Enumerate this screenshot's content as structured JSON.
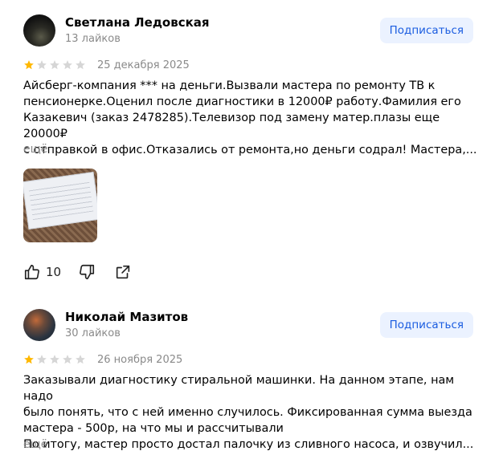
{
  "reviews": [
    {
      "author_name": "Светлана Ледовская",
      "likes_label": "13 лайков",
      "subscribe_label": "Подписаться",
      "rating": 1,
      "date": "25 декабря 2025",
      "text": "Айсберг-компания *** на деньги.Вызвали мастера по ремонту ТВ к\nпенсионерке.Оценил после диагностики в 12000₽ работу.Фамилия его\nКазакевич (заказ 2478285).Телевизор под замену матер.плазы еще 20000₽\nс отправкой в офис.Отказались от ремонта,но деньги содрал! Мастера,...",
      "more_label": "ещё",
      "like_count": "10"
    },
    {
      "author_name": "Николай Мазитов",
      "likes_label": "30 лайков",
      "subscribe_label": "Подписаться",
      "rating": 1,
      "date": "26 ноября 2025",
      "text": "Заказывали диагностику стиральной машинки. На данном этапе, нам надо\nбыло понять, что с ней именно случилось. Фиксированная сумма выезда\nмастера - 500р, на что мы и рассчитывали\nПо итогу, мастер просто достал палочку из сливного насоса, и озвучил...",
      "more_label": "ещё"
    }
  ],
  "colors": {
    "star_filled": "#ffb800",
    "star_empty": "#d6d6d6",
    "subscribe_bg": "#ebf2ff",
    "subscribe_text": "#1a5ce0",
    "muted": "#8a8a8a"
  },
  "icons": [
    "thumb-up-icon",
    "thumb-down-icon",
    "share-icon"
  ]
}
